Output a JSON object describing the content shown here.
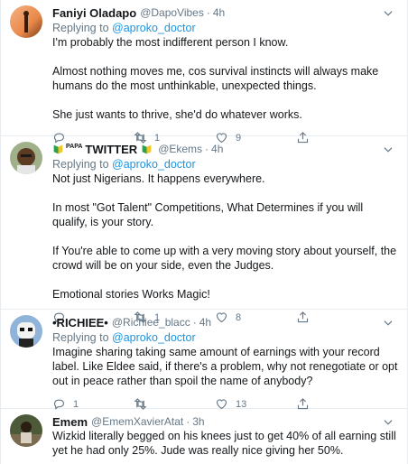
{
  "tweets": [
    {
      "name": "Faniyi Oladapo",
      "handle": "@DapoVibes",
      "time": "4h",
      "replying_prefix": "Replying to",
      "replying_to": "@aproko_doctor",
      "paragraphs": [
        "I'm probably the most indifferent person I know.",
        "Almost nothing moves me, cos survival instincts will always make humans do the most unthinkable, unexpected things.",
        "She just wants to thrive, she'd do whatever works."
      ],
      "replies": "",
      "retweets": "1",
      "likes": "9"
    },
    {
      "name_prefix": "PAPA",
      "name": "TWITTER",
      "handle": "@Ekems",
      "time": "4h",
      "replying_prefix": "Replying to",
      "replying_to": "@aproko_doctor",
      "paragraphs": [
        "Not just Nigerians. It happens everywhere.",
        "In most \"Got Talent\" Competitions, What Determines if you will qualify, is your story.",
        "If You're able to come up with a very moving story about yourself, the crowd will be on your side, even the Judges.",
        "Emotional stories Works Magic!"
      ],
      "replies": "",
      "retweets": "1",
      "likes": "8"
    },
    {
      "name": "•RICHIEE•",
      "handle": "@Richiee_blacc",
      "time": "4h",
      "replying_prefix": "Replying to",
      "replying_to": "@aproko_doctor",
      "paragraphs": [
        "Imagine sharing taking same amount of earnings with your record label. Like Eldee said, if there's a problem, why not renegotiate or opt out in peace rather than spoil the name of anybody?"
      ],
      "replies": "1",
      "retweets": "",
      "likes": "13"
    },
    {
      "name": "Emem",
      "handle": "@EmemXavierAtat",
      "time": "3h",
      "paragraphs": [
        "Wizkid literally begged on his knees just to get 40% of all earning still yet he had only 25%. Jude was really nice giving her 50%."
      ]
    }
  ]
}
